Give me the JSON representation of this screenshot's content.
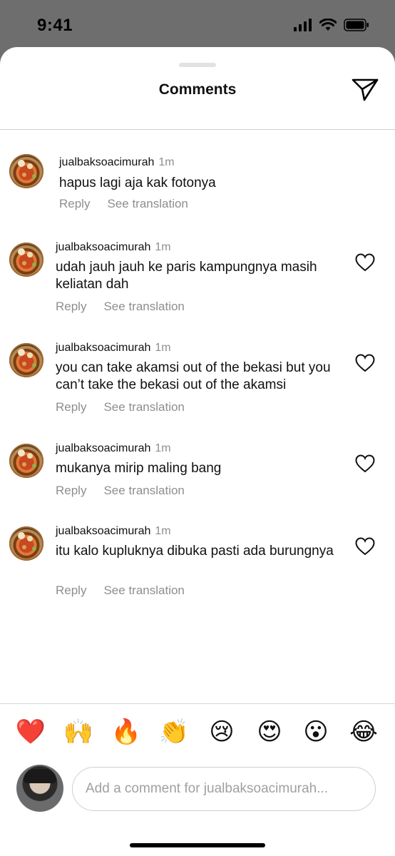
{
  "status": {
    "time": "9:41"
  },
  "sheet": {
    "title": "Comments"
  },
  "comments": [
    {
      "username": "jualbaksoacimurah",
      "time": "1m",
      "text": "hapus lagi aja kak fotonya",
      "reply": "Reply",
      "translate": "See translation"
    },
    {
      "username": "jualbaksoacimurah",
      "time": "1m",
      "text": "udah jauh jauh ke paris kampungnya masih keliatan dah",
      "reply": "Reply",
      "translate": "See translation"
    },
    {
      "username": "jualbaksoacimurah",
      "time": "1m",
      "text": "you can take akamsi out of the bekasi but you can’t take the bekasi out of the akamsi",
      "reply": "Reply",
      "translate": "See translation"
    },
    {
      "username": "jualbaksoacimurah",
      "time": "1m",
      "text": "mukanya mirip maling bang",
      "reply": "Reply",
      "translate": "See translation"
    },
    {
      "username": "jualbaksoacimurah",
      "time": "1m",
      "text": "itu kalo kupluknya dibuka pasti ada burungnya",
      "reply": "Reply",
      "translate": "See translation"
    }
  ],
  "emojis": [
    "❤️",
    "🙌",
    "🔥",
    "👏",
    "😢",
    "😍",
    "😮",
    "😂"
  ],
  "composer": {
    "placeholder": "Add a comment for jualbaksoacimurah..."
  },
  "icons": {
    "send": "paper-plane-icon",
    "like": "heart-outline-icon"
  }
}
